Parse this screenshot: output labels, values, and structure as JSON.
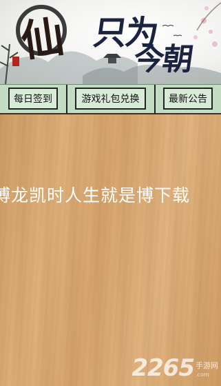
{
  "banner": {
    "logo_char": "仙",
    "title_line1": "只为",
    "title_line2": "今朝"
  },
  "toolbar": {
    "daily_signin": "每日签到",
    "gift_redeem": "游戏礼包兑换",
    "latest_notice": "最新公告"
  },
  "content": {
    "scrolling_notice": "博龙凯时人生就是博下载"
  },
  "watermark": {
    "number": "2265",
    "site_cn": "手游网",
    "domain": ".com"
  }
}
